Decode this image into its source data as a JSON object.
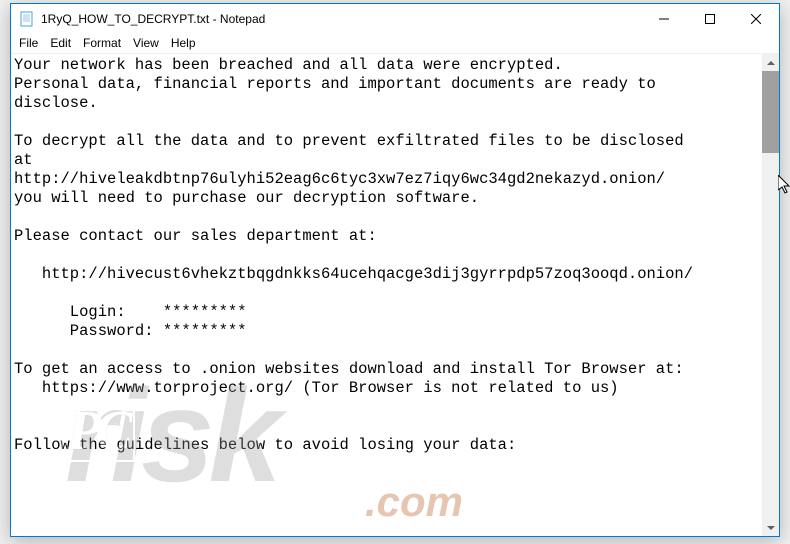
{
  "window": {
    "title": "1RyQ_HOW_TO_DECRYPT.txt - Notepad"
  },
  "menubar": {
    "items": [
      "File",
      "Edit",
      "Format",
      "View",
      "Help"
    ]
  },
  "document": {
    "text": "Your network has been breached and all data were encrypted.\nPersonal data, financial reports and important documents are ready to\ndisclose.\n\nTo decrypt all the data and to prevent exfiltrated files to be disclosed\nat\nhttp://hiveleakdbtnp76ulyhi52eag6c6tyc3xw7ez7iqy6wc34gd2nekazyd.onion/\nyou will need to purchase our decryption software.\n\nPlease contact our sales department at:\n\n   http://hivecust6vhekztbqgdnkks64ucehqacge3dij3gyrrpdp57zoq3ooqd.onion/\n\n      Login:    *********\n      Password: *********\n\nTo get an access to .onion websites download and install Tor Browser at:\n   https://www.torproject.org/ (Tor Browser is not related to us)\n\n\nFollow the guidelines below to avoid losing your data:"
  },
  "watermark": {
    "brand_pc": "PC",
    "brand_risk": "risk",
    "tld": ".com"
  }
}
